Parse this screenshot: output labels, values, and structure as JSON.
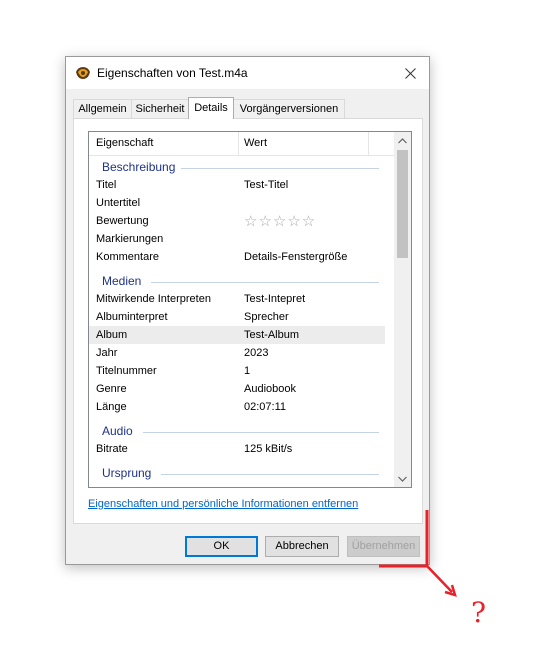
{
  "window": {
    "title": "Eigenschaften von Test.m4a",
    "icon": "audio-file-icon",
    "close_icon": "close-icon"
  },
  "tabs": [
    {
      "label": "Allgemein",
      "active": false
    },
    {
      "label": "Sicherheit",
      "active": false
    },
    {
      "label": "Details",
      "active": true
    },
    {
      "label": "Vorgängerversionen",
      "active": false
    }
  ],
  "details": {
    "columns": {
      "property": "Eigenschaft",
      "value": "Wert"
    },
    "groups": {
      "beschreibung": "Beschreibung",
      "medien": "Medien",
      "audio": "Audio",
      "ursprung": "Ursprung"
    },
    "rows": {
      "titel": {
        "name": "Titel",
        "value": "Test-Titel"
      },
      "untertitel": {
        "name": "Untertitel",
        "value": ""
      },
      "bewertung": {
        "name": "Bewertung",
        "value": "☆☆☆☆☆",
        "rating": 0,
        "max": 5
      },
      "markierungen": {
        "name": "Markierungen",
        "value": ""
      },
      "kommentare": {
        "name": "Kommentare",
        "value": "Details-Fenstergröße"
      },
      "interpreten": {
        "name": "Mitwirkende Interpreten",
        "value": "Test-Intepret"
      },
      "albuminterpret": {
        "name": "Albuminterpret",
        "value": "Sprecher"
      },
      "album": {
        "name": "Album",
        "value": "Test-Album",
        "selected": true
      },
      "jahr": {
        "name": "Jahr",
        "value": "2023"
      },
      "titelnummer": {
        "name": "Titelnummer",
        "value": "1"
      },
      "genre": {
        "name": "Genre",
        "value": "Audiobook"
      },
      "laenge": {
        "name": "Länge",
        "value": "02:07:11"
      },
      "bitrate": {
        "name": "Bitrate",
        "value": "125 kBit/s"
      }
    }
  },
  "remove_link": "Eigenschaften und persönliche Informationen entfernen",
  "buttons": {
    "ok": "OK",
    "cancel": "Abbrechen",
    "apply": "Übernehmen",
    "apply_disabled": true
  },
  "annotation": {
    "text": "?",
    "color": "#e8212b"
  }
}
